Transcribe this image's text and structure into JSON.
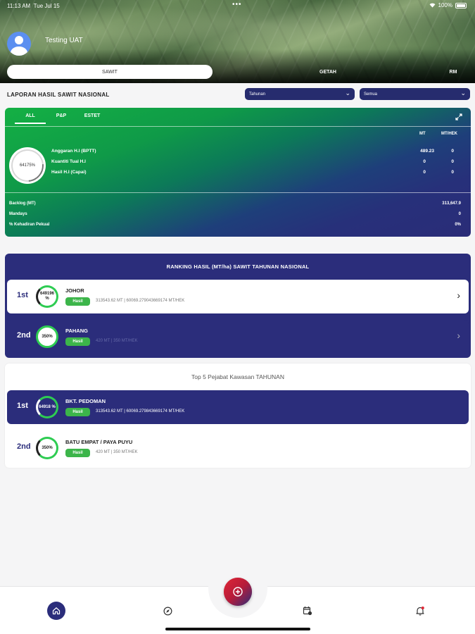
{
  "status": {
    "time": "11:13 AM",
    "date": "Tue Jul 15",
    "dots": "•••",
    "battery": "100%"
  },
  "user": {
    "name": "Testing UAT"
  },
  "tabs": [
    {
      "label": "SAWIT",
      "active": true
    },
    {
      "label": "GETAH",
      "active": false
    },
    {
      "label": "RM",
      "active": false
    }
  ],
  "report": {
    "title": "LAPORAN HASIL SAWIT NASIONAL",
    "period_select": "Tahunan",
    "scope_select": "Semua"
  },
  "summary": {
    "tabs": [
      {
        "label": "ALL",
        "active": true
      },
      {
        "label": "P&P",
        "active": false
      },
      {
        "label": "ESTET",
        "active": false
      }
    ],
    "col_mt": "MT",
    "col_mthek": "MT/HEK",
    "percent": "64175%",
    "metrics": [
      {
        "label": "Anggaran H.I (BPTT)",
        "mt": "489.23",
        "mthek": "0"
      },
      {
        "label": "Kuantiti Tual H.I",
        "mt": "0",
        "mthek": "0"
      },
      {
        "label": "Hasil H.I (Capai)",
        "mt": "0",
        "mthek": "0"
      }
    ],
    "bottom": [
      {
        "label": "Backlog (MT)",
        "value": "313,647.9"
      },
      {
        "label": "Mandays",
        "value": "0"
      },
      {
        "label": "% Kehadiran Pekual",
        "value": "0%"
      }
    ]
  },
  "ranking": {
    "title": "RANKING HASIL (MT/ha) SAWIT TAHUNAN NASIONAL",
    "items": [
      {
        "rank": "1st",
        "pct": "649196 %",
        "name": "JOHOR",
        "badge": "Hasil",
        "detail": "313543.62 MT | 60069.279043669174 MT/HEK"
      },
      {
        "rank": "2nd",
        "pct": "350%",
        "name": "PAHANG",
        "badge": "Hasil",
        "detail": "420 MT | 350 MT/HEK"
      }
    ]
  },
  "top5": {
    "title": "Top 5 Pejabat Kawasan TAHUNAN",
    "items": [
      {
        "rank": "1st",
        "pct": "64918 %",
        "name": "BKT. PEDOMAN",
        "badge": "Hasil",
        "detail": "313543.62 MT | 60069.279843669174 MT/HEK"
      },
      {
        "rank": "2nd",
        "pct": "350%",
        "name": "BATU EMPAT / PAYA PUYU",
        "badge": "Hasil",
        "detail": "420 MT | 350 MT/HEK"
      }
    ]
  },
  "nav": {
    "items": [
      {
        "icon": "home-icon"
      },
      {
        "icon": "compass-icon"
      },
      {
        "icon": "add-icon"
      },
      {
        "icon": "calendar-icon"
      },
      {
        "icon": "bell-icon"
      }
    ]
  }
}
